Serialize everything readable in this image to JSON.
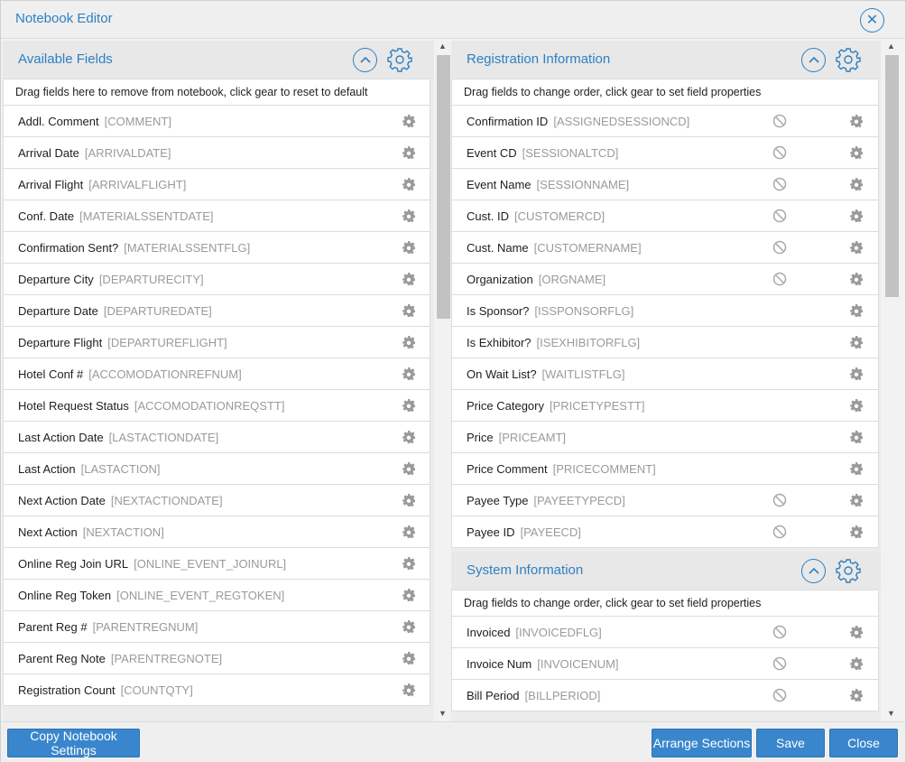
{
  "title": "Notebook Editor",
  "available": {
    "title": "Available Fields",
    "hint": "Drag fields here to remove from notebook, click gear to reset to default",
    "fields": [
      {
        "label": "Addl. Comment",
        "code": "[COMMENT]"
      },
      {
        "label": "Arrival Date",
        "code": "[ARRIVALDATE]"
      },
      {
        "label": "Arrival Flight",
        "code": "[ARRIVALFLIGHT]"
      },
      {
        "label": "Conf. Date",
        "code": "[MATERIALSSENTDATE]"
      },
      {
        "label": "Confirmation Sent?",
        "code": "[MATERIALSSENTFLG]"
      },
      {
        "label": "Departure City",
        "code": "[DEPARTURECITY]"
      },
      {
        "label": "Departure Date",
        "code": "[DEPARTUREDATE]"
      },
      {
        "label": "Departure Flight",
        "code": "[DEPARTUREFLIGHT]"
      },
      {
        "label": "Hotel Conf #",
        "code": "[ACCOMODATIONREFNUM]"
      },
      {
        "label": "Hotel Request Status",
        "code": "[ACCOMODATIONREQSTT]"
      },
      {
        "label": "Last Action Date",
        "code": "[LASTACTIONDATE]"
      },
      {
        "label": "Last Action",
        "code": "[LASTACTION]"
      },
      {
        "label": "Next Action Date",
        "code": "[NEXTACTIONDATE]"
      },
      {
        "label": "Next Action",
        "code": "[NEXTACTION]"
      },
      {
        "label": "Online Reg Join URL",
        "code": "[ONLINE_EVENT_JOINURL]"
      },
      {
        "label": "Online Reg Token",
        "code": "[ONLINE_EVENT_REGTOKEN]"
      },
      {
        "label": "Parent Reg #",
        "code": "[PARENTREGNUM]"
      },
      {
        "label": "Parent Reg Note",
        "code": "[PARENTREGNOTE]"
      },
      {
        "label": "Registration Count",
        "code": "[COUNTQTY]"
      }
    ]
  },
  "registration": {
    "title": "Registration Information",
    "hint": "Drag fields to change order, click gear to set field properties",
    "fields": [
      {
        "label": "Confirmation ID",
        "code": "[ASSIGNEDSESSIONCD]",
        "locked": true
      },
      {
        "label": "Event CD",
        "code": "[SESSIONALTCD]",
        "locked": true
      },
      {
        "label": "Event Name",
        "code": "[SESSIONNAME]",
        "locked": true
      },
      {
        "label": "Cust. ID",
        "code": "[CUSTOMERCD]",
        "locked": true
      },
      {
        "label": "Cust. Name",
        "code": "[CUSTOMERNAME]",
        "locked": true
      },
      {
        "label": "Organization",
        "code": "[ORGNAME]",
        "locked": true
      },
      {
        "label": "Is Sponsor?",
        "code": "[ISSPONSORFLG]",
        "locked": false
      },
      {
        "label": "Is Exhibitor?",
        "code": "[ISEXHIBITORFLG]",
        "locked": false
      },
      {
        "label": "On Wait List?",
        "code": "[WAITLISTFLG]",
        "locked": false
      },
      {
        "label": "Price Category",
        "code": "[PRICETYPESTT]",
        "locked": false
      },
      {
        "label": "Price",
        "code": "[PRICEAMT]",
        "locked": false
      },
      {
        "label": "Price Comment",
        "code": "[PRICECOMMENT]",
        "locked": false
      },
      {
        "label": "Payee Type",
        "code": "[PAYEETYPECD]",
        "locked": true
      },
      {
        "label": "Payee ID",
        "code": "[PAYEECD]",
        "locked": true
      }
    ]
  },
  "system": {
    "title": "System Information",
    "hint": "Drag fields to change order, click gear to set field properties",
    "fields": [
      {
        "label": "Invoiced",
        "code": "[INVOICEDFLG]",
        "locked": true
      },
      {
        "label": "Invoice Num",
        "code": "[INVOICENUM]",
        "locked": true
      },
      {
        "label": "Bill Period",
        "code": "[BILLPERIOD]",
        "locked": true
      }
    ]
  },
  "footer": {
    "copy": "Copy Notebook Settings",
    "arrange": "Arrange Sections",
    "save": "Save",
    "close": "Close"
  },
  "colors": {
    "accent": "#2f7fc1",
    "button": "#3a86cc",
    "icon_gray": "#9a9a9a"
  },
  "icons": {
    "close": "close-icon",
    "collapse": "chevron-up-icon",
    "settings": "gear-icon",
    "locked": "ban-icon"
  }
}
